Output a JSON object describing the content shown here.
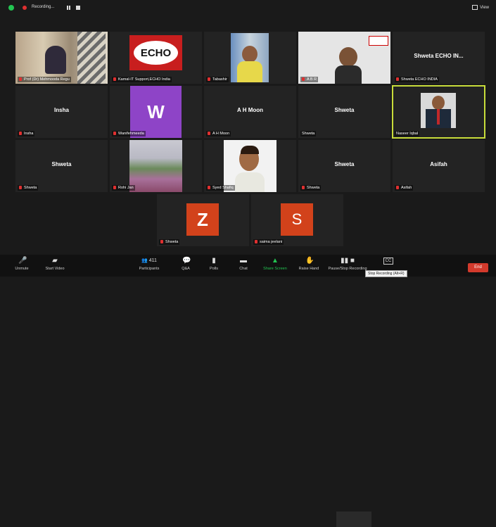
{
  "topbar": {
    "recording_label": "Recording...",
    "view_label": "View"
  },
  "colors": {
    "background": "#1a1a1a",
    "tile": "#232323",
    "active_speaker": "#c8dc3a",
    "end_button": "#d33a2c",
    "share_green": "#23c552",
    "muted_red": "#e03030",
    "avatar_w": "#8e44c7",
    "avatar_z": "#d2421b",
    "avatar_s": "#d2421b"
  },
  "participants": [
    {
      "label": "Prof (Dr) Mehmooda Regu",
      "center_name": ""
    },
    {
      "label": "Kamal-IT Support,ECHO India",
      "center_name": ""
    },
    {
      "label": "Tabashir",
      "center_name": ""
    },
    {
      "label": "A B R",
      "center_name": ""
    },
    {
      "label": "Shweta ECHO INDIA",
      "center_name": "Shweta ECHO IN..."
    },
    {
      "label": "Insha",
      "center_name": "Insha"
    },
    {
      "label": "Wanifehmeeda",
      "avatar_letter": "W"
    },
    {
      "label": "A H Moon",
      "center_name": "A H Moon"
    },
    {
      "label": "Shweta",
      "center_name": "Shweta"
    },
    {
      "label": "Naseer Iqbal",
      "center_name": ""
    },
    {
      "label": "Shweta",
      "center_name": "Shweta"
    },
    {
      "label": "Rohi Jan",
      "center_name": ""
    },
    {
      "label": "Syed Shafiq",
      "center_name": ""
    },
    {
      "label": "Shweta",
      "center_name": "Shweta"
    },
    {
      "label": "Asifah",
      "center_name": "Asifah"
    },
    {
      "label": "Shweta",
      "avatar_letter": "Z"
    },
    {
      "label": "saima jeelani",
      "avatar_letter": "S"
    }
  ],
  "echo_logo": {
    "text": "ECHO",
    "small": "Project"
  },
  "controls": {
    "unmute": "Unmute",
    "start_video": "Start Video",
    "participants": "Participants",
    "participants_count": "411",
    "qa": "Q&A",
    "polls": "Polls",
    "chat": "Chat",
    "share_screen": "Share Screen",
    "raise_hand": "Raise Hand",
    "pause_stop": "Pause/Stop Recording",
    "cc": "CC",
    "end": "End",
    "tooltip": "Stop Recording (Alt+R)"
  }
}
